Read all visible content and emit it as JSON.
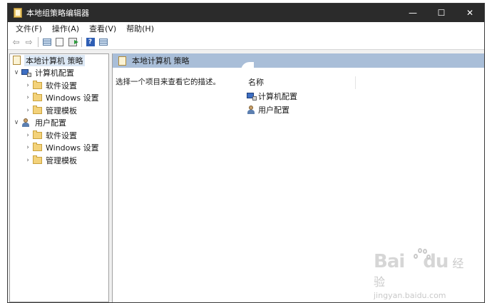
{
  "window": {
    "title": "本地组策略编辑器",
    "controls": {
      "minimize": "—",
      "maximize": "☐",
      "close": "✕"
    }
  },
  "menubar": [
    "文件(F)",
    "操作(A)",
    "查看(V)",
    "帮助(H)"
  ],
  "toolbar": {
    "back": "⇦",
    "forward": "⇨",
    "help": "?"
  },
  "tree": {
    "root": "本地计算机 策略",
    "computer_config": {
      "label": "计算机配置",
      "children": [
        "软件设置",
        "Windows 设置",
        "管理模板"
      ]
    },
    "user_config": {
      "label": "用户配置",
      "children": [
        "软件设置",
        "Windows 设置",
        "管理模板"
      ]
    },
    "expand_glyph": "∨",
    "collapse_glyph": "›"
  },
  "details": {
    "header": "本地计算机 策略",
    "description": "选择一个项目来查看它的描述。",
    "column_name": "名称",
    "items": [
      "计算机配置",
      "用户配置"
    ]
  },
  "watermark": {
    "brand": "Bai",
    "brand_right": "du",
    "sub": "经验",
    "url": "jingyan.baidu.com"
  }
}
